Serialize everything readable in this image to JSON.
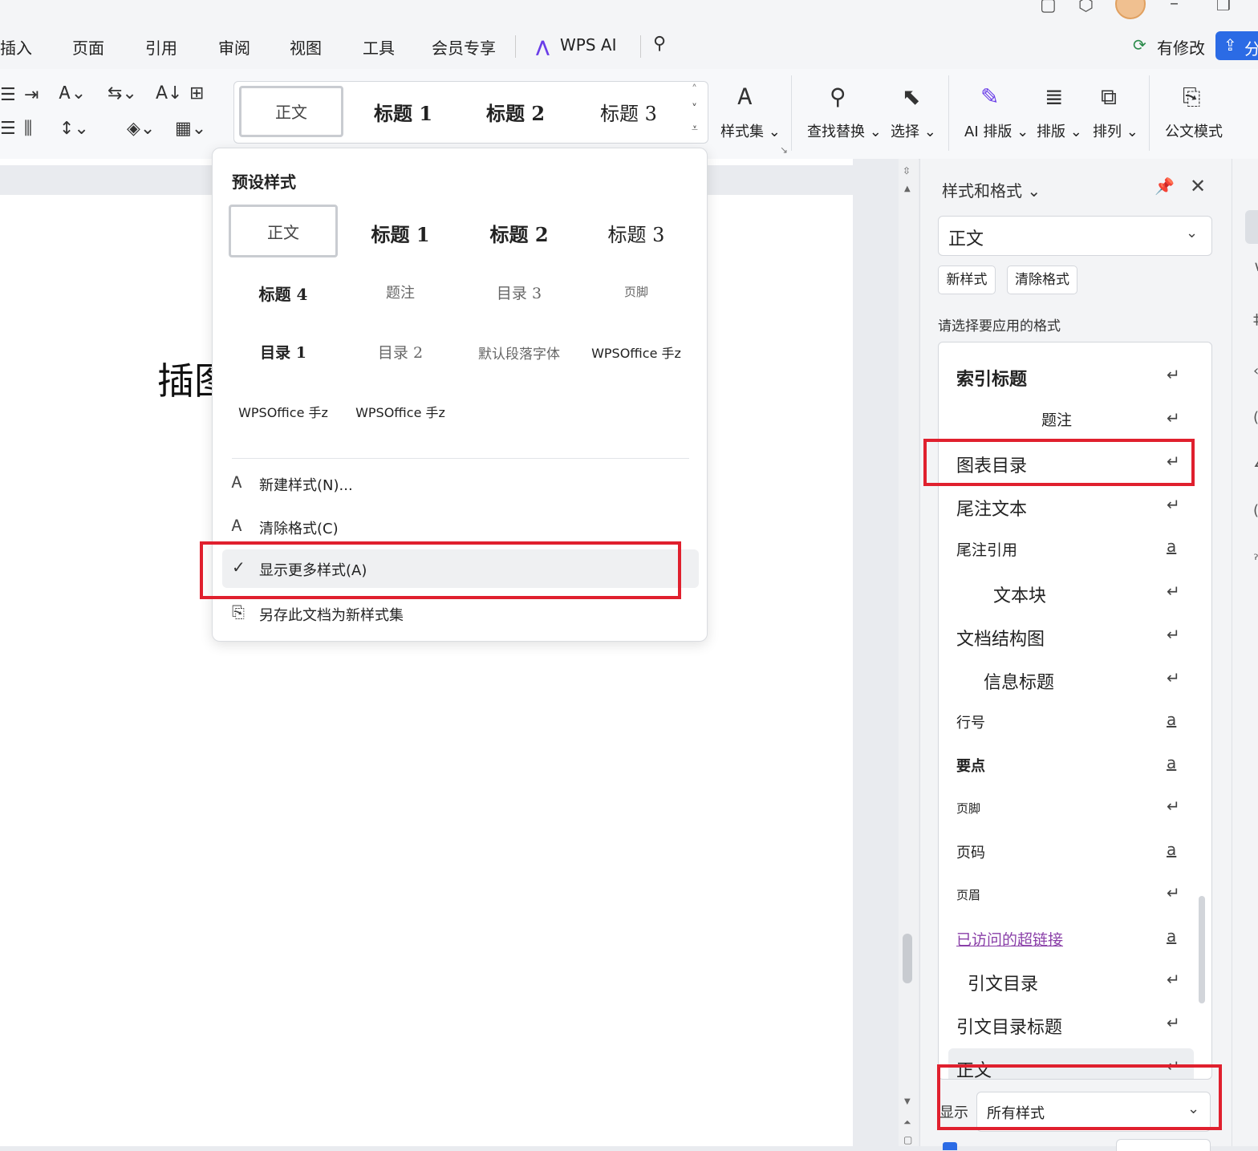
{
  "menu": {
    "tabs": [
      "插入",
      "页面",
      "引用",
      "审阅",
      "视图",
      "工具",
      "会员专享"
    ],
    "ai_tab": "WPS AI",
    "revise_label": "有修改",
    "share_label": "分"
  },
  "ribbon": {
    "style_gallery": [
      "正文",
      "标题 1",
      "标题 2",
      "标题 3"
    ],
    "style_set": "样式集",
    "find_replace": "查找替换",
    "select": "选择",
    "ai_layout": "AI 排版",
    "layout": "排版",
    "arrange": "排列",
    "official_doc": "公文模式"
  },
  "document": {
    "visible_text": "插图"
  },
  "dropdown": {
    "title": "预设样式",
    "styles": [
      "正文",
      "标题 1",
      "标题 2",
      "标题 3",
      "标题 4",
      "题注",
      "目录 3",
      "页脚",
      "目录 1",
      "目录 2",
      "默认段落字体",
      "WPSOffice 手z",
      "WPSOffice 手z",
      "WPSOffice 手z"
    ],
    "commands": {
      "new_style": "新建样式(N)...",
      "clear_format": "清除格式(C)",
      "show_more": "显示更多样式(A)",
      "save_as_set": "另存此文档为新样式集"
    }
  },
  "panel": {
    "title": "样式和格式",
    "current_style": "正文",
    "new_style_btn": "新样式",
    "clear_btn": "清除格式",
    "hint": "请选择要应用的格式",
    "styles": [
      {
        "name": "索引标题",
        "mark": "↵"
      },
      {
        "name": "题注",
        "mark": "↵"
      },
      {
        "name": "图表目录",
        "mark": "↵"
      },
      {
        "name": "尾注文本",
        "mark": "↵"
      },
      {
        "name": "尾注引用",
        "mark": "a"
      },
      {
        "name": "文本块",
        "mark": "↵"
      },
      {
        "name": "文档结构图",
        "mark": "↵"
      },
      {
        "name": "信息标题",
        "mark": "↵"
      },
      {
        "name": "行号",
        "mark": "a"
      },
      {
        "name": "要点",
        "mark": "a"
      },
      {
        "name": "页脚",
        "mark": "↵"
      },
      {
        "name": "页码",
        "mark": "a"
      },
      {
        "name": "页眉",
        "mark": "↵"
      },
      {
        "name": "已访问的超链接",
        "mark": "a"
      },
      {
        "name": "引文目录",
        "mark": "↵"
      },
      {
        "name": "引文目录标题",
        "mark": "↵"
      },
      {
        "name": "正文",
        "mark": "↵"
      }
    ],
    "show_label": "显示",
    "show_value": "所有样式"
  },
  "colors": {
    "highlight": "#e0202e",
    "accent": "#2b6be5",
    "visited_link": "#8a3fa8"
  }
}
